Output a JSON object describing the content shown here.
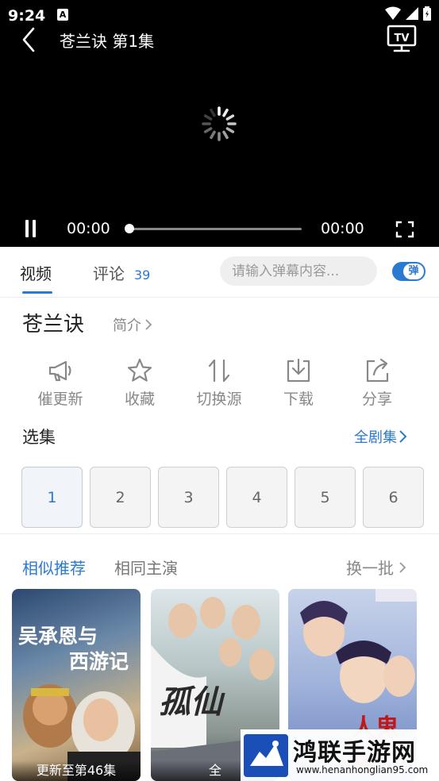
{
  "status_bar": {
    "time": "9:24",
    "notification_badge": "A"
  },
  "player": {
    "title": "苍兰诀 第1集",
    "current_time": "00:00",
    "total_time": "00:00",
    "progress": 0,
    "loading": true,
    "tv_icon": "TV"
  },
  "tabs": [
    {
      "label": "视频",
      "active": true
    },
    {
      "label": "评论",
      "count": "39",
      "active": false
    }
  ],
  "danmu": {
    "placeholder": "请输入弹幕内容...",
    "toggle_label": "弹",
    "enabled": true
  },
  "show": {
    "title": "苍兰诀",
    "intro_link": "简介"
  },
  "actions": [
    {
      "label": "催更新",
      "icon": "megaphone-icon"
    },
    {
      "label": "收藏",
      "icon": "star-icon"
    },
    {
      "label": "切换源",
      "icon": "swap-icon"
    },
    {
      "label": "下载",
      "icon": "download-icon"
    },
    {
      "label": "分享",
      "icon": "share-icon"
    }
  ],
  "episodes": {
    "header": "选集",
    "all_link": "全剧集",
    "items": [
      "1",
      "2",
      "3",
      "4",
      "5",
      "6"
    ],
    "selected": "1"
  },
  "recommendations": {
    "tabs": [
      "相似推荐",
      "相同主演"
    ],
    "refresh_label": "换一批",
    "posters": [
      {
        "title_line1": "吴承恩与",
        "title_line2": "西游记",
        "badge": "更新至第46集"
      },
      {
        "title_line1": "孤仙",
        "badge": "全"
      },
      {
        "title_line1": "人鬼缘",
        "badge": ""
      }
    ]
  },
  "watermark": {
    "text": "鸿联手游网",
    "url": "www.henanhonglian95.com"
  },
  "colors": {
    "accent": "#2a7ad2",
    "player_bg": "#000000"
  }
}
